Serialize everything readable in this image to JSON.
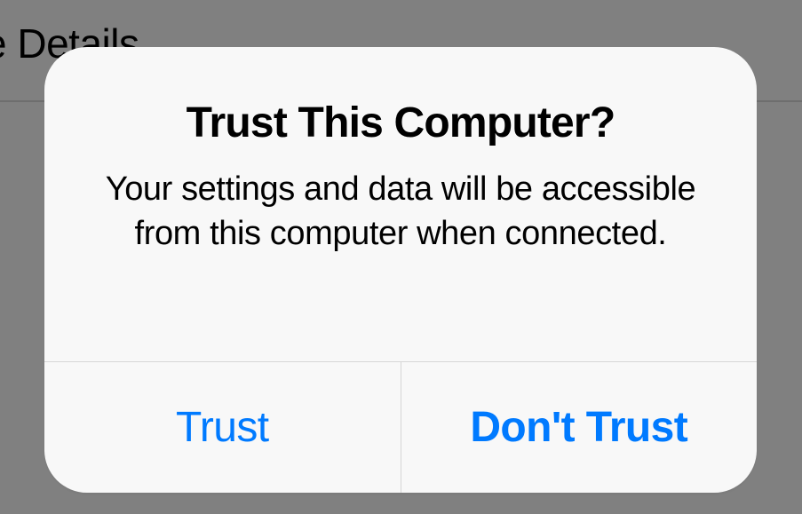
{
  "background": {
    "header_text": "e Details"
  },
  "dialog": {
    "title": "Trust This Computer?",
    "message": "Your settings and data will be accessible from this computer when connected.",
    "buttons": {
      "trust": "Trust",
      "dont_trust": "Don't Trust"
    }
  },
  "colors": {
    "accent": "#007aff",
    "dialog_bg": "#f8f8f8",
    "overlay": "#808080",
    "divider": "#d6d6d6"
  }
}
